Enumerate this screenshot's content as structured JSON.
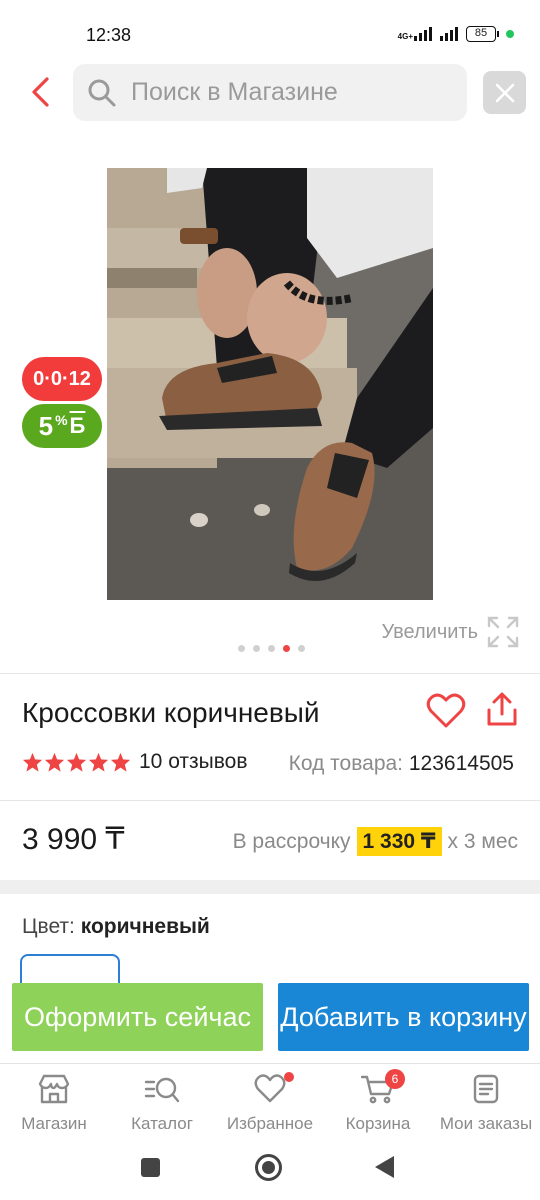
{
  "status": {
    "time": "12:38",
    "network": "4G+",
    "battery": "85"
  },
  "search": {
    "placeholder": "Поиск в Магазине"
  },
  "badges": {
    "timer": "0·0·12",
    "bonus_value": "5",
    "bonus_percent": "%",
    "bonus_currency": "Б"
  },
  "gallery": {
    "zoom_label": "Увеличить",
    "total_images": 5,
    "active_index": 3
  },
  "product": {
    "title": "Кроссовки коричневый",
    "rating": 5,
    "reviews": "10 отзывов",
    "sku_label": "Код товара:",
    "sku_value": "123614505",
    "price": "3 990 ₸",
    "installment_prefix": "В рассрочку",
    "installment_amount": "1 330 ₸",
    "installment_suffix": "х 3 мес",
    "color_label": "Цвет:",
    "color_value": "коричневый"
  },
  "actions": {
    "buy_now": "Оформить сейчас",
    "add_to_cart": "Добавить в корзину"
  },
  "nav": {
    "items": [
      {
        "label": "Магазин"
      },
      {
        "label": "Каталог"
      },
      {
        "label": "Избранное"
      },
      {
        "label": "Корзина",
        "badge": "6"
      },
      {
        "label": "Мои заказы"
      }
    ]
  },
  "colors": {
    "accent_red": "#ef4444",
    "buy_green": "#8fd25a",
    "cart_blue": "#1a86d6",
    "installment_yellow": "#ffd20a"
  }
}
